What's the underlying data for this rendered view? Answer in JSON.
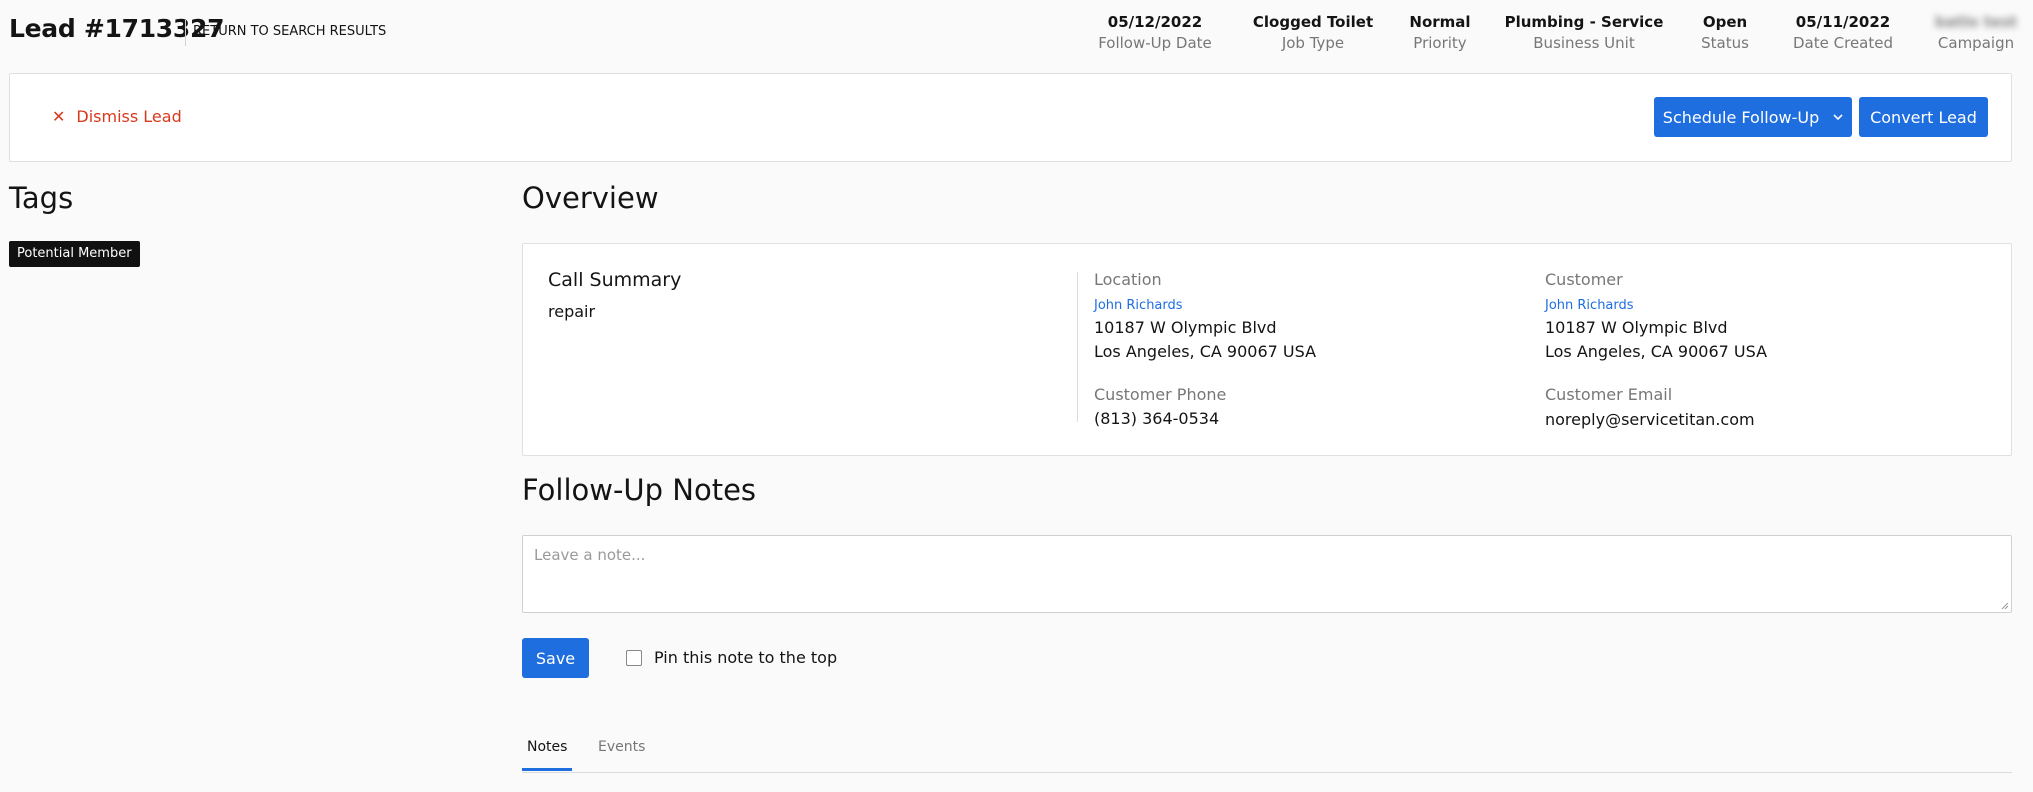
{
  "header": {
    "lead_title": "Lead #1713327",
    "return_label": "RETURN TO SEARCH RESULTS",
    "meta": [
      {
        "value": "05/12/2022",
        "label": "Follow-Up Date"
      },
      {
        "value": "Clogged Toilet",
        "label": "Job Type"
      },
      {
        "value": "Normal",
        "label": "Priority"
      },
      {
        "value": "Plumbing - Service",
        "label": "Business Unit"
      },
      {
        "value": "Open",
        "label": "Status"
      },
      {
        "value": "05/11/2022",
        "label": "Date Created"
      },
      {
        "value": "batlo test",
        "label": "Campaign"
      }
    ]
  },
  "actions": {
    "dismiss_label": "Dismiss Lead",
    "schedule_label": "Schedule Follow-Up",
    "convert_label": "Convert Lead"
  },
  "tags": {
    "title": "Tags",
    "items": [
      "Potential Member"
    ]
  },
  "overview": {
    "title": "Overview",
    "call_summary_title": "Call Summary",
    "call_summary_text": "repair",
    "location": {
      "label": "Location",
      "name": "John Richards",
      "address_line1": "10187 W Olympic Blvd",
      "address_line2": "Los Angeles, CA 90067 USA"
    },
    "customer": {
      "label": "Customer",
      "name": "John Richards",
      "address_line1": "10187 W Olympic Blvd",
      "address_line2": "Los Angeles, CA 90067 USA"
    },
    "phone": {
      "label": "Customer Phone",
      "value": "(813) 364-0534"
    },
    "email": {
      "label": "Customer Email",
      "value": "noreply@servicetitan.com"
    }
  },
  "notes": {
    "title": "Follow-Up Notes",
    "placeholder": "Leave a note...",
    "value": "",
    "save_label": "Save",
    "pin_label": "Pin this note to the top",
    "pin_checked": false
  },
  "tabs": [
    {
      "label": "Notes",
      "active": true
    },
    {
      "label": "Events",
      "active": false
    }
  ],
  "colors": {
    "accent": "#1e6ee0",
    "danger": "#d8391d",
    "tag_bg": "#111111"
  }
}
